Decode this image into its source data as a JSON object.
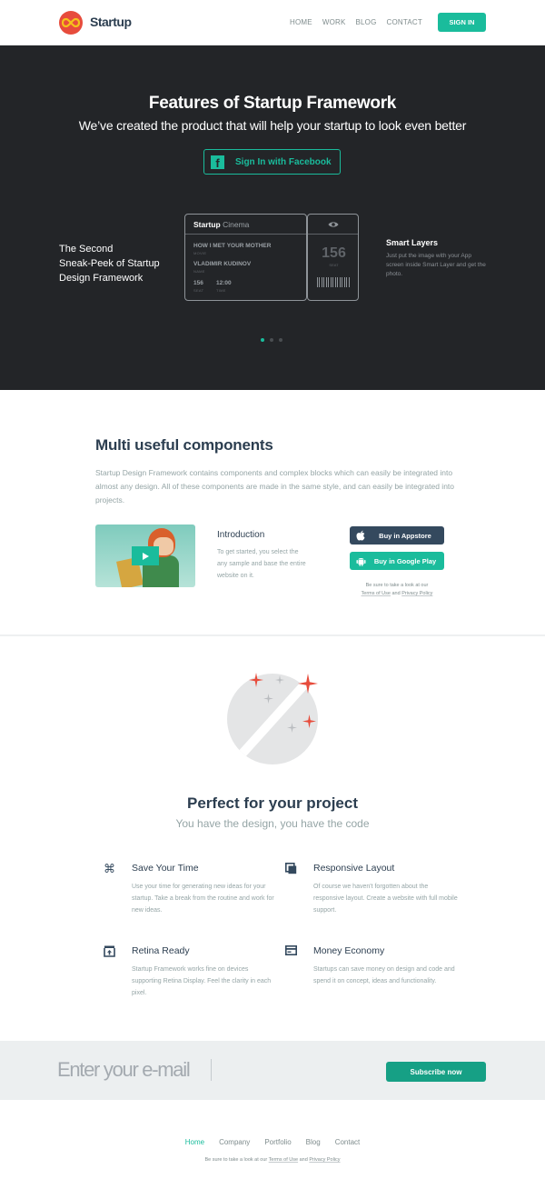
{
  "header": {
    "brand": "Startup",
    "logo_icon": "infinity-icon",
    "nav": [
      "HOME",
      "WORK",
      "BLOG",
      "CONTACT"
    ],
    "signin_label": "SIGN IN",
    "accent": "#1abc9c"
  },
  "hero": {
    "title": "Features of Startup Framework",
    "subtitle": "We’ve created the product that will help your startup to look even better",
    "facebook_button": "Sign In with Facebook",
    "sneak_lines": [
      "The Second",
      "Sneak-Peek of Startup",
      "Design Framework"
    ],
    "smart_title": "Smart Layers",
    "smart_text": "Just put the image with your App screen inside Smart Layer and get the photo.",
    "ticket": {
      "brand": "Startup",
      "brand_suffix": "Cinema",
      "movie": "HOW I MET YOUR MOTHER",
      "movie_label": "MOVIE",
      "name": "VLADIMIR KUDINOV",
      "name_label": "NAME",
      "seat": "156",
      "seat_label": "SEAT",
      "time": "12:00",
      "time_label": "TIME",
      "stub_seat": "156",
      "stub_seat_label": "SEAT"
    },
    "slider": {
      "total": 3,
      "active": 1
    },
    "background": "#232528"
  },
  "components": {
    "title": "Multi useful components",
    "text": "Startup Design Framework contains components and complex blocks which can easily be integrated into almost any design. All of these components are made in the same style, and can easily be integrated into projects.",
    "intro_title": "Introduction",
    "intro_text": "To get started, you select the any sample and base the entire website on it.",
    "appstore_label": "Buy in Appstore",
    "gplay_label": "Buy in Google Play",
    "terms_prefix": "Be sure to take a look at our",
    "terms_link": "Terms of Use",
    "terms_and": "and",
    "privacy_link": "Privacy Policy"
  },
  "perfect": {
    "title": "Perfect for your project",
    "subtitle": "You have the design, you have the code",
    "features": [
      {
        "icon": "command-icon",
        "title": "Save Your Time",
        "text": "Use your time for generating new ideas for your startup. Take a break from the routine and work for new ideas."
      },
      {
        "icon": "windows-icon",
        "title": "Responsive Layout",
        "text": "Of course we haven't forgotten about the responsive layout. Create a website with full mobile support."
      },
      {
        "icon": "upload-box-icon",
        "title": "Retina Ready",
        "text": "Startup Framework works fine on devices supporting Retina Display. Feel the clarity in each pixel."
      },
      {
        "icon": "card-icon",
        "title": "Money Economy",
        "text": "Startups can save money on design and code and spend it on concept, ideas and functionality."
      }
    ]
  },
  "subscribe": {
    "placeholder": "Enter your e-mail",
    "button": "Subscribe now"
  },
  "footer": {
    "nav": [
      "Home",
      "Company",
      "Portfolio",
      "Blog",
      "Contact"
    ],
    "active": "Home",
    "terms_prefix": "Be sure to take a look at our",
    "terms_link": "Terms of Use",
    "terms_and": "and",
    "privacy_link": "Privacy Policy"
  }
}
